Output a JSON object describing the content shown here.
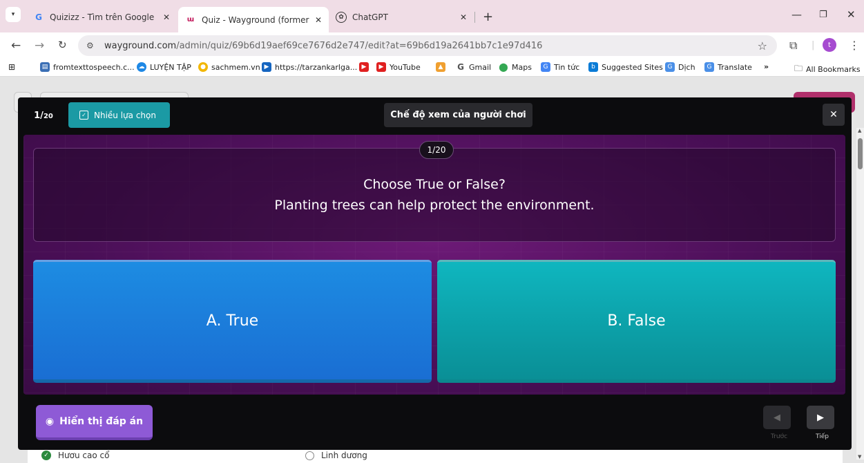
{
  "browser": {
    "tabs": [
      {
        "title": "Quizizz - Tìm trên Google",
        "favicon": "G"
      },
      {
        "title": "Quiz - Wayground (formerly Qu",
        "favicon": "wf"
      },
      {
        "title": "ChatGPT",
        "favicon": "chatgpt-icon"
      }
    ],
    "url_host": "wayground.com",
    "url_path": "/admin/quiz/69b6d19aef69ce7676d2e747/edit?at=69b6d19a2641bb7c1e97d416",
    "avatar_letter": "t",
    "bookmarks": [
      "fromtexttospeech.c...",
      "LUYỆN TẬP",
      "sachmem.vn",
      "https://tarzankarlga...",
      "YouTube",
      "Gmail",
      "Maps",
      "Tin tức",
      "Suggested Sites",
      "Dịch",
      "Translate"
    ],
    "all_bookmarks": "All Bookmarks"
  },
  "modal": {
    "counter_num": "1/",
    "counter_den": "20",
    "question_type": "Nhiều lựa chọn",
    "mode_label": "Chế độ xem của người chơi",
    "badge": "1/20",
    "question_line1": "Choose True or False?",
    "question_line2": "Planting trees can help protect the environment.",
    "answer_a": "A. True",
    "answer_b": "B. False",
    "show_answer": "Hiển thị đáp án",
    "prev_label": "Trước",
    "next_label": "Tiếp"
  },
  "background": {
    "option_correct": "Hươu cao cổ",
    "option_other": "Linh dương"
  },
  "colors": {
    "answer_a": "#1d8ce2",
    "answer_b": "#0fb6bf",
    "question_type_bg": "#1b9aa4",
    "show_answer_bg": "#8e5ad6"
  }
}
